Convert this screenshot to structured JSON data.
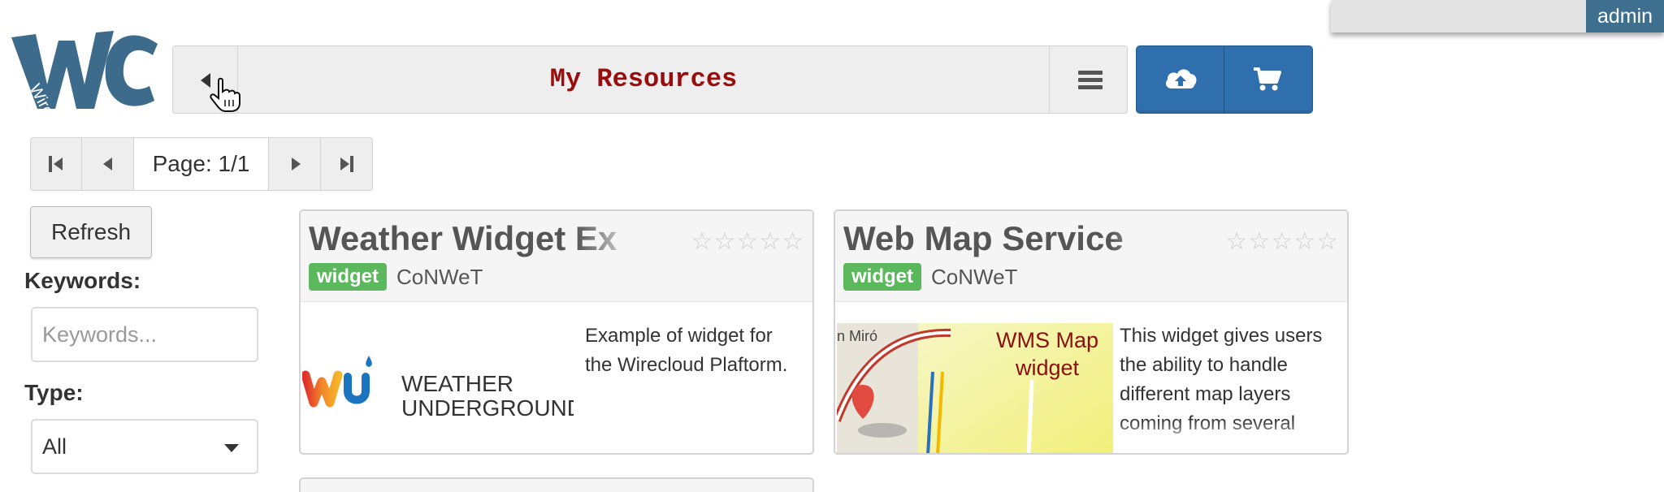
{
  "user": {
    "name": "admin"
  },
  "logo": {
    "text": "Wirecloud"
  },
  "header": {
    "title": "My Resources"
  },
  "pagination": {
    "label": "Page: 1/1"
  },
  "sidebar": {
    "refresh_label": "Refresh",
    "keywords_label": "Keywords:",
    "keywords_placeholder": "Keywords...",
    "type_label": "Type:",
    "type_value": "All"
  },
  "resources": [
    {
      "title": "Weather Widget Ex",
      "type": "widget",
      "vendor": "CoNWeT",
      "stars": "☆☆☆☆☆",
      "image_text_1": "WEATHER",
      "image_text_2": "UNDERGROUND",
      "description": "Example of widget for the Wirecloud Plaftorm."
    },
    {
      "title": "Web Map Service",
      "type": "widget",
      "vendor": "CoNWeT",
      "stars": "☆☆☆☆☆",
      "image_text_1": "WMS Map",
      "image_text_2": "widget",
      "image_text_3": "n Miró",
      "description": "This widget gives users the ability to handle different map layers coming from several"
    }
  ],
  "colors": {
    "title": "#9b0d0d",
    "accent_blue": "#2f6fae",
    "badge_green": "#5cb85c",
    "admin_bg": "#3e6f8f"
  }
}
